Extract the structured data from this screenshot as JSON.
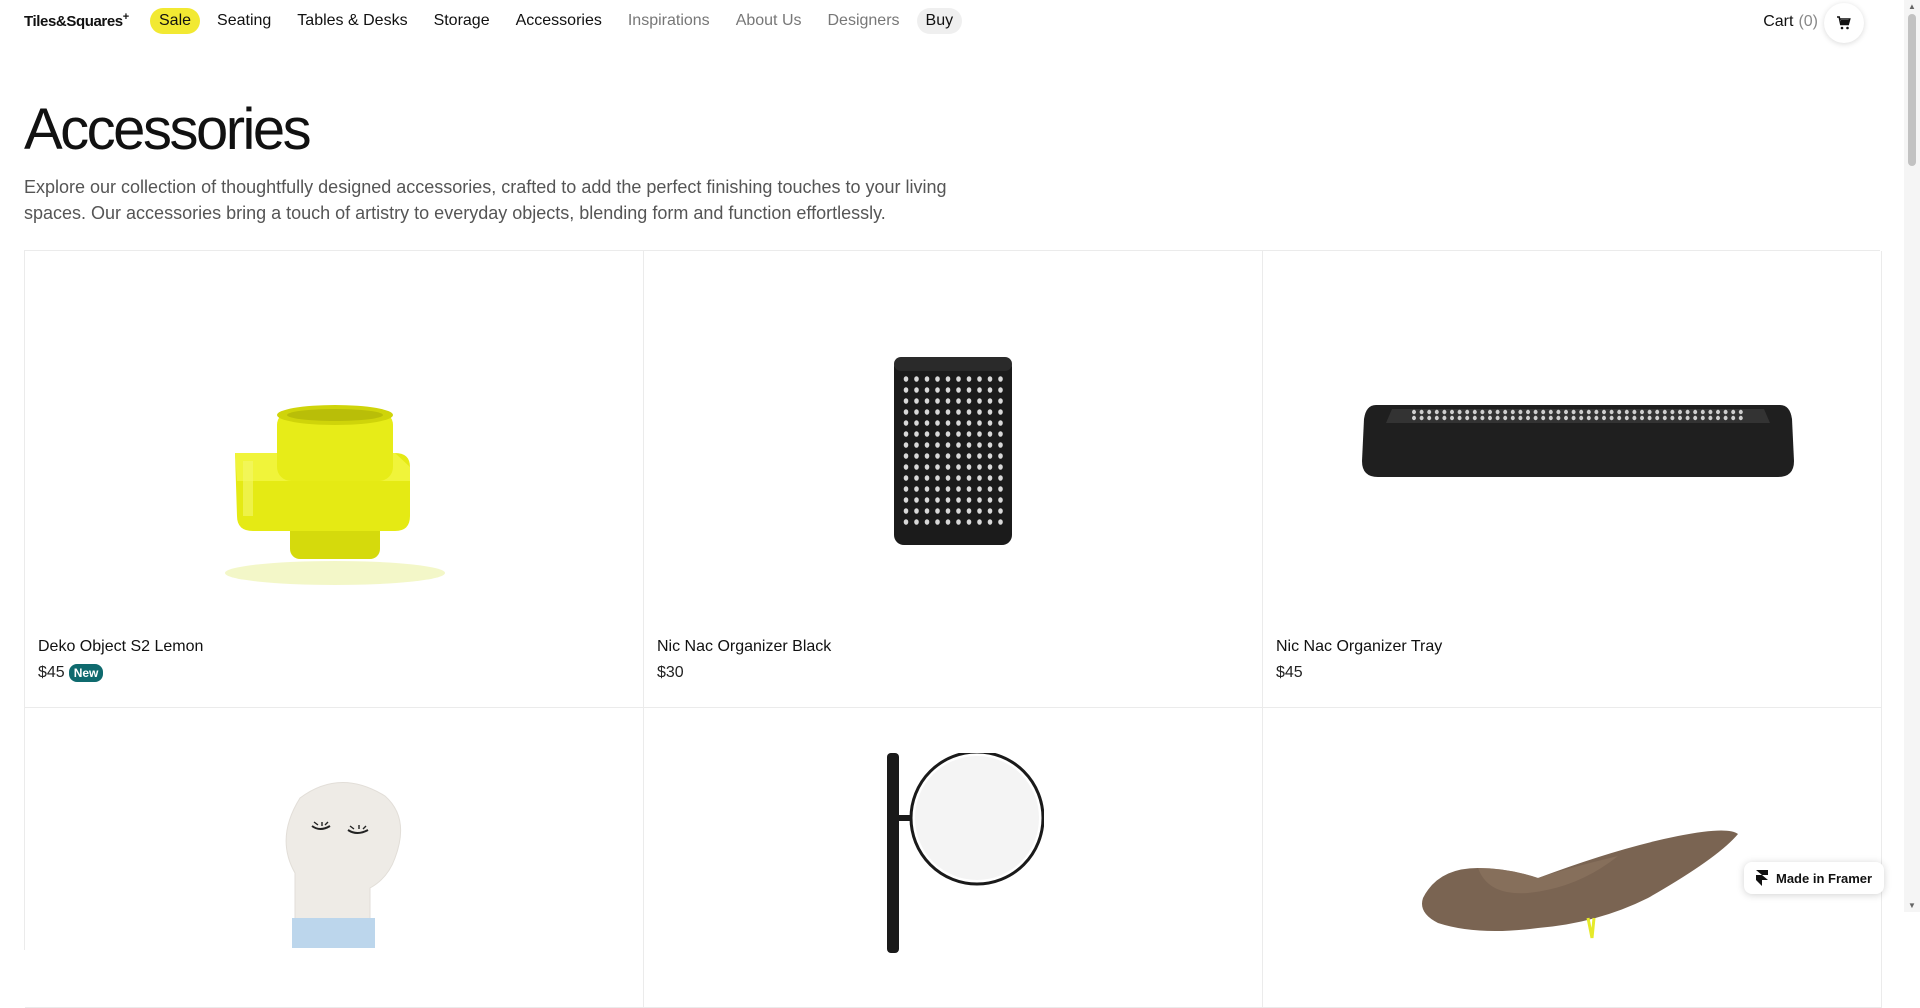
{
  "nav": {
    "logo": "Tiles&Squares",
    "logo_plus": "+",
    "links": [
      "Sale",
      "Seating",
      "Tables & Desks",
      "Storage",
      "Accessories",
      "Inspirations",
      "About Us",
      "Designers",
      "Buy"
    ],
    "cart_label": "Cart",
    "cart_count": "(0)"
  },
  "page": {
    "title": "Accessories",
    "intro": "Explore our collection of thoughtfully designed accessories, crafted to add the perfect finishing touches to your living spaces. Our accessories bring a touch of artistry to everyday objects, blending form and function effortlessly."
  },
  "products": [
    {
      "name": "Deko Object S2 Lemon",
      "price": "$45",
      "badge": "New"
    },
    {
      "name": "Nic Nac Organizer Black",
      "price": "$30",
      "badge": ""
    },
    {
      "name": "Nic Nac Organizer Tray",
      "price": "$45",
      "badge": ""
    }
  ],
  "colors": {
    "sale_highlight": "#f2e932",
    "badge": "#0f6a6e",
    "lemon": "#e5ea14"
  },
  "framer_badge": "Made in Framer"
}
